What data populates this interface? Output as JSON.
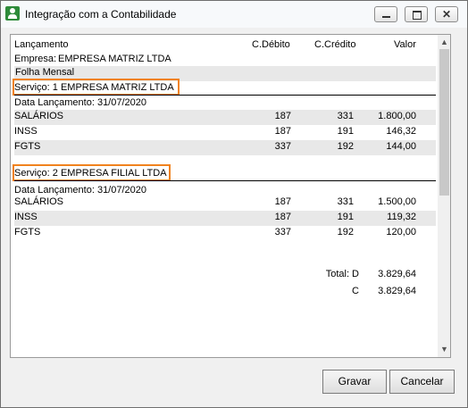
{
  "window": {
    "title": "Integração com a Contabilidade"
  },
  "header": {
    "lancamento": "Lançamento",
    "debito": "C.Débito",
    "credito": "C.Crédito",
    "valor": "Valor"
  },
  "empresa": {
    "label": "Empresa:",
    "value": "EMPRESA MATRIZ LTDA"
  },
  "section": "Folha Mensal",
  "services": [
    {
      "title": "Serviço: 1 EMPRESA MATRIZ LTDA",
      "date": "Data Lançamento: 31/07/2020",
      "rows": [
        {
          "name": "SALÁRIOS",
          "debito": "187",
          "credito": "331",
          "valor": "1.800,00"
        },
        {
          "name": "INSS",
          "debito": "187",
          "credito": "191",
          "valor": "146,32"
        },
        {
          "name": "FGTS",
          "debito": "337",
          "credito": "192",
          "valor": "144,00"
        }
      ]
    },
    {
      "title": "Serviço: 2 EMPRESA FILIAL LTDA",
      "date": "Data Lançamento: 31/07/2020",
      "rows": [
        {
          "name": "SALÁRIOS",
          "debito": "187",
          "credito": "331",
          "valor": "1.500,00"
        },
        {
          "name": "INSS",
          "debito": "187",
          "credito": "191",
          "valor": "119,32"
        },
        {
          "name": "FGTS",
          "debito": "337",
          "credito": "192",
          "valor": "120,00"
        }
      ]
    }
  ],
  "totals": {
    "label_d": "Total: D",
    "value_d": "3.829,64",
    "label_c": "C",
    "value_c": "3.829,64"
  },
  "buttons": {
    "save": "Gravar",
    "cancel": "Cancelar"
  },
  "icons": {
    "app": "app-person-icon",
    "up": "scroll-up-icon",
    "down": "scroll-down-icon"
  }
}
